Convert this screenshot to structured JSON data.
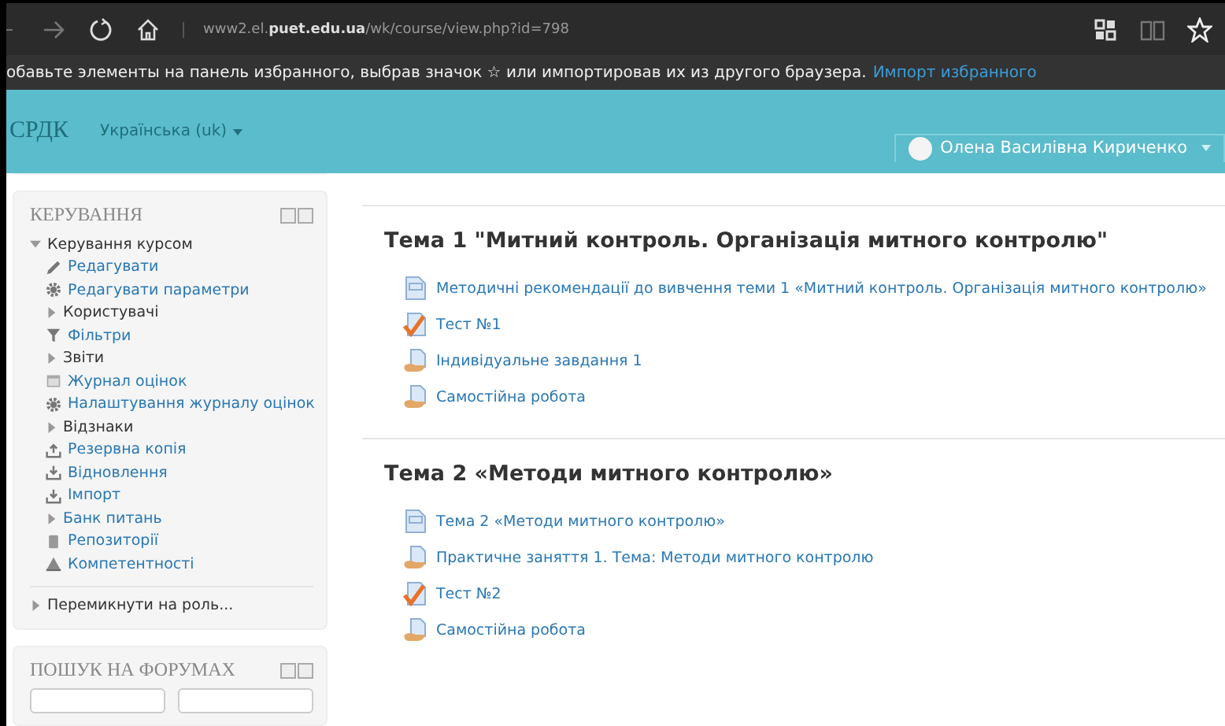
{
  "browser": {
    "url": "www2.el.**puet.edu.ua**/wk/course/view.php?id=798"
  },
  "favorites_bar": {
    "message": "обавьте элементы на панель избранного, выбрав значок ☆ или импортировав их из другого браузера.",
    "link": "Импорт избранного"
  },
  "header": {
    "logo": "СРДК",
    "language": "Українська (uk)",
    "user": "Олена Василівна Кириченко"
  },
  "sidebar": {
    "blocks": [
      {
        "title": "КЕРУВАННЯ",
        "tree": [
          {
            "kind": "branch",
            "label": "Керування курсом",
            "expanded": true,
            "children": [
              {
                "kind": "edit",
                "label": "Редагувати"
              },
              {
                "kind": "settings",
                "label": "Редагувати параметри"
              },
              {
                "kind": "branch",
                "label": "Користувачі",
                "expanded": false
              },
              {
                "kind": "filter",
                "label": "Фільтри"
              },
              {
                "kind": "branch",
                "label": "Звіти",
                "expanded": false
              },
              {
                "kind": "grades",
                "label": "Журнал оцінок"
              },
              {
                "kind": "settings",
                "label": "Налаштування журналу оцінок"
              },
              {
                "kind": "branch",
                "label": "Відзнаки",
                "expanded": false
              },
              {
                "kind": "backup",
                "label": "Резервна копія"
              },
              {
                "kind": "restore",
                "label": "Відновлення"
              },
              {
                "kind": "restore",
                "label": "Імпорт"
              },
              {
                "kind": "branch",
                "label": "Банк питань",
                "expanded": false,
                "link": true
              },
              {
                "kind": "repository",
                "label": "Репозиторії"
              },
              {
                "kind": "competency",
                "label": "Компетентності"
              }
            ]
          },
          {
            "kind": "branch",
            "label": "Перемикнути на роль...",
            "expanded": false,
            "separated": true
          }
        ]
      },
      {
        "title": "ПОШУК НА ФОРУМАХ",
        "search": true
      }
    ]
  },
  "sections": [
    {
      "title": "Тема 1 \"Митний контроль. Організація митного контролю\"",
      "activities": [
        {
          "kind": "page",
          "label": "Методичні рекомендації до вивчення теми 1 «Митний контроль. Організація митного контролю»"
        },
        {
          "kind": "quiz",
          "label": "Тест №1"
        },
        {
          "kind": "assign",
          "label": "Індивідуальне завдання 1"
        },
        {
          "kind": "assign",
          "label": "Самостійна робота"
        }
      ]
    },
    {
      "title": "Тема 2 «Методи митного контролю»",
      "activities": [
        {
          "kind": "page",
          "label": "Тема 2 «Методи митного контролю»"
        },
        {
          "kind": "assign",
          "label": "Практичне заняття 1. Тема: Методи митного контролю"
        },
        {
          "kind": "quiz",
          "label": "Тест №2"
        },
        {
          "kind": "assign",
          "label": "Самостійна робота"
        }
      ]
    }
  ]
}
